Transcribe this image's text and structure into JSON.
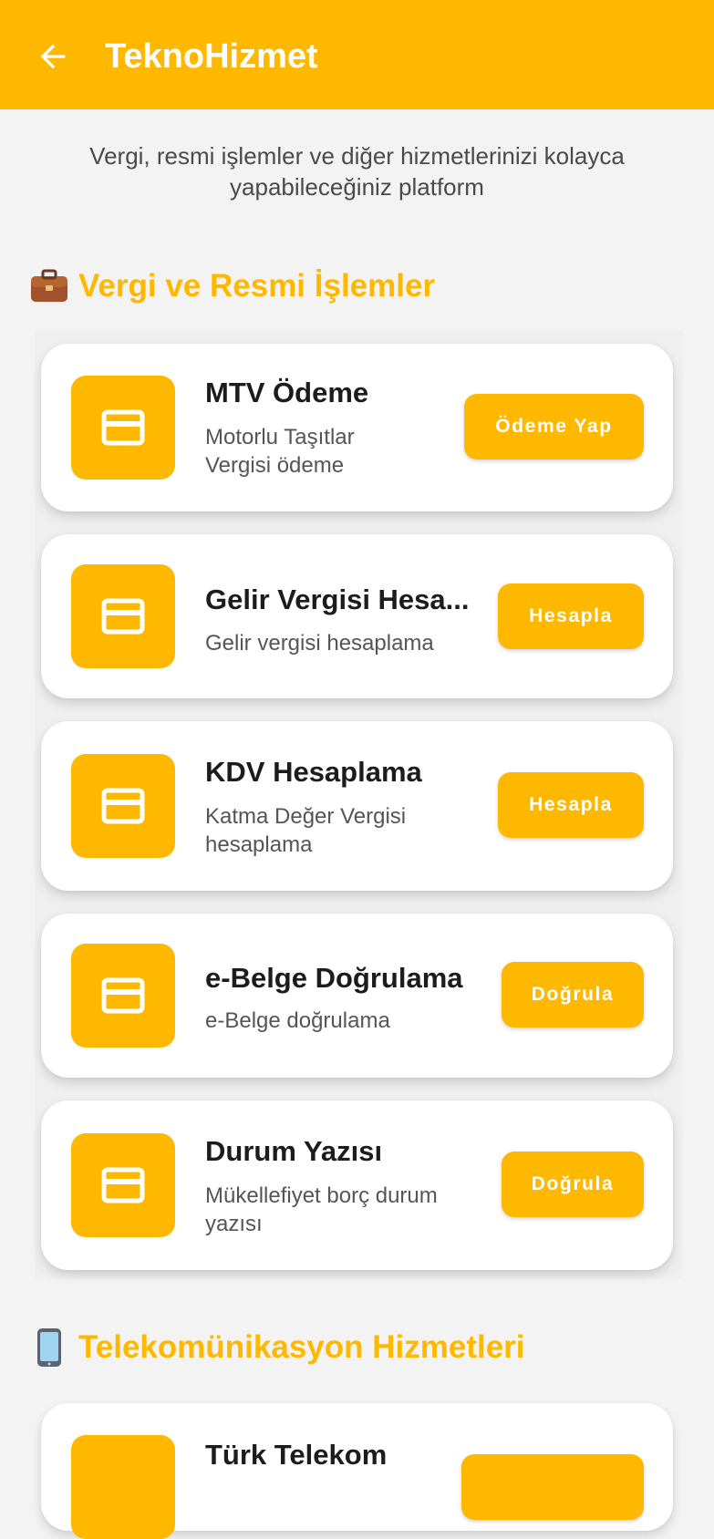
{
  "appbar": {
    "title": "TeknoHizmet",
    "color": "#FFB800"
  },
  "subtitle": "Vergi, resmi işlemler ve diğer hizmetlerinizi kolayca yapabileceğiniz platform",
  "sections": [
    {
      "icon": "briefcase-icon",
      "title": "Vergi ve Resmi İşlemler"
    },
    {
      "icon": "mobile-phone-icon",
      "title": "Telekomünikasyon Hizmetleri"
    }
  ],
  "cards": [
    {
      "icon": "credit-card-icon",
      "title": "MTV Ödeme",
      "desc_line1": "Motorlu Taşıtlar",
      "desc_line2": "Vergisi ödeme",
      "button": "Ödeme Yap"
    },
    {
      "icon": "credit-card-icon",
      "title": "Gelir Vergisi Hesa...",
      "desc_line1": "Gelir vergisi hesaplama",
      "desc_line2": "",
      "button": "Hesapla"
    },
    {
      "icon": "credit-card-icon",
      "title": "KDV Hesaplama",
      "desc_line1": "Katma Değer Vergisi",
      "desc_line2": "hesaplama",
      "button": "Hesapla"
    },
    {
      "icon": "credit-card-icon",
      "title": "e-Belge Doğrulama",
      "desc_line1": "e-Belge doğrulama",
      "desc_line2": "",
      "button": "Doğrula"
    },
    {
      "icon": "credit-card-icon",
      "title": "Durum Yazısı",
      "desc_line1": "Mükellefiyet borç durum",
      "desc_line2": "yazısı",
      "button": "Doğrula"
    },
    {
      "icon": "credit-card-icon",
      "title": "Türk Telekom",
      "desc_line1": "",
      "desc_line2": "",
      "button": ""
    }
  ]
}
